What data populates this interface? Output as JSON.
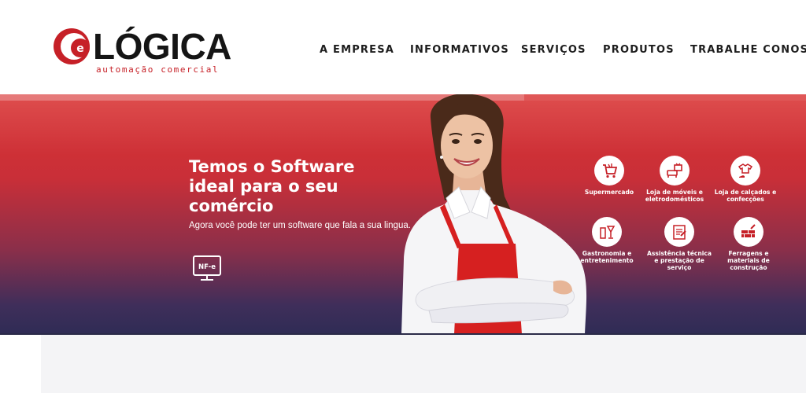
{
  "brand": {
    "name": "LÓGICA",
    "tagline": "automação comercial",
    "colors": {
      "red": "#c62027",
      "dark": "#151515"
    }
  },
  "nav": {
    "items": [
      {
        "label": "A EMPRESA"
      },
      {
        "label": "INFORMATIVOS"
      },
      {
        "label": "SERVIÇOS"
      },
      {
        "label": "PRODUTOS"
      },
      {
        "label": "TRABALHE CONOSCO"
      }
    ]
  },
  "hero": {
    "headline": "Temos o Software ideal para o seu comércio",
    "subline": "Agora você pode ter um software que fala a sua lingua.",
    "nfe_label": "NF-e",
    "colors": {
      "top": "#d93232",
      "bottom": "#2f2c55"
    }
  },
  "categories": [
    {
      "label": "Supermercado",
      "icon": "shopping-cart-icon"
    },
    {
      "label": "Loja de móveis e eletrodomésticos",
      "icon": "tv-furniture-icon"
    },
    {
      "label": "Loja de calçados e confecções",
      "icon": "shirt-shoe-icon"
    },
    {
      "label": "Gastronomia e entretenimento",
      "icon": "drinks-icon"
    },
    {
      "label": "Assistência técnica e prestação de serviço",
      "icon": "tools-document-icon"
    },
    {
      "label": "Ferragens e materiais de construção",
      "icon": "bricks-icon"
    }
  ]
}
